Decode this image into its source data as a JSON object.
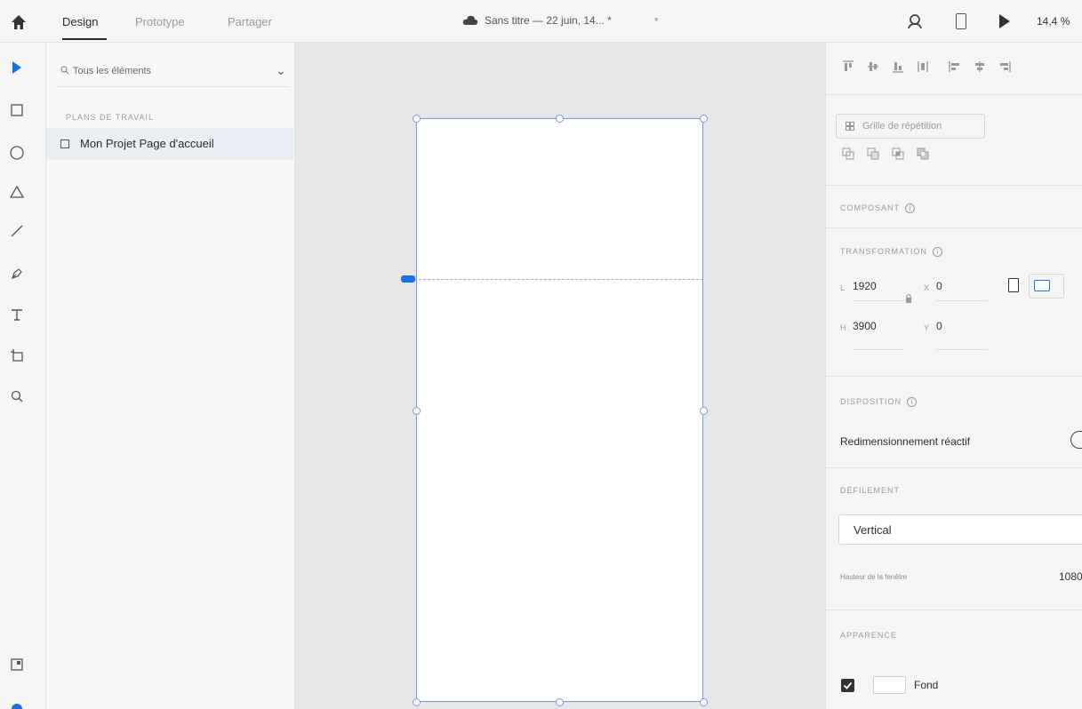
{
  "topbar": {
    "tabs": [
      "Design",
      "Prototype",
      "Partager"
    ],
    "document_title": "Sans titre — 22 juin, 14... *",
    "zoom": "14,4 %"
  },
  "layers": {
    "search_placeholder": "Tous les éléments",
    "section_label": "PLANS DE TRAVAIL",
    "artboard_name": "Mon Projet Page d'accueil"
  },
  "props": {
    "repeat_grid": "Grille de répétition",
    "component_label": "COMPOSANT",
    "transform_label": "TRANSFORMATION",
    "w_label": "L",
    "w_value": "1920",
    "x_label": "X",
    "x_value": "0",
    "h_label": "H",
    "h_value": "3900",
    "y_label": "Y",
    "y_value": "0",
    "layout_label": "DISPOSITION",
    "responsive_label": "Redimensionnement réactif",
    "scroll_label": "DÉFILEMENT",
    "scroll_value": "Vertical",
    "viewport_label": "Hauteur de la fenêtre",
    "viewport_value": "1080",
    "appearance_label": "APPARENCE",
    "fill_label": "Fond",
    "info_glyph": "i"
  },
  "colors": {
    "accent": "#1473e6",
    "selection": "#7a9cd6",
    "canvas": "#e6e6e6"
  }
}
